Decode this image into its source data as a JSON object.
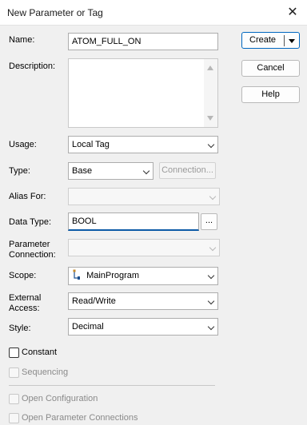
{
  "window": {
    "title": "New Parameter or Tag",
    "close_icon": "close-icon",
    "close_glyph": "✕"
  },
  "buttons": {
    "create": "Create",
    "cancel": "Cancel",
    "help": "Help",
    "browse": "...",
    "connection": "Connection..."
  },
  "labels": {
    "name": "Name:",
    "description": "Description:",
    "usage": "Usage:",
    "type": "Type:",
    "alias_for": "Alias For:",
    "data_type": "Data Type:",
    "parameter_connection_1": "Parameter",
    "parameter_connection_2": "Connection:",
    "scope": "Scope:",
    "external_access_1": "External",
    "external_access_2": "Access:",
    "style": "Style:"
  },
  "values": {
    "name": "ATOM_FULL_ON",
    "description": "",
    "usage": "Local Tag",
    "type": "Base",
    "alias_for": "",
    "data_type": "BOOL",
    "parameter_connection": "",
    "scope": "MainProgram",
    "external_access": "Read/Write",
    "style": "Decimal"
  },
  "checkboxes": {
    "constant": {
      "label": "Constant",
      "checked": false,
      "enabled": true
    },
    "sequencing": {
      "label": "Sequencing",
      "checked": false,
      "enabled": false
    },
    "open_configuration": {
      "label": "Open Configuration",
      "checked": false,
      "enabled": false
    },
    "open_parameter_connections": {
      "label": "Open Parameter Connections",
      "checked": false,
      "enabled": false
    }
  },
  "colors": {
    "accent": "#0067c0",
    "background": "#f0f0f0",
    "focus_underline": "#0c5aa6"
  },
  "icons": {
    "scope": "program-tree-icon",
    "combo": "chevron-down-icon"
  }
}
